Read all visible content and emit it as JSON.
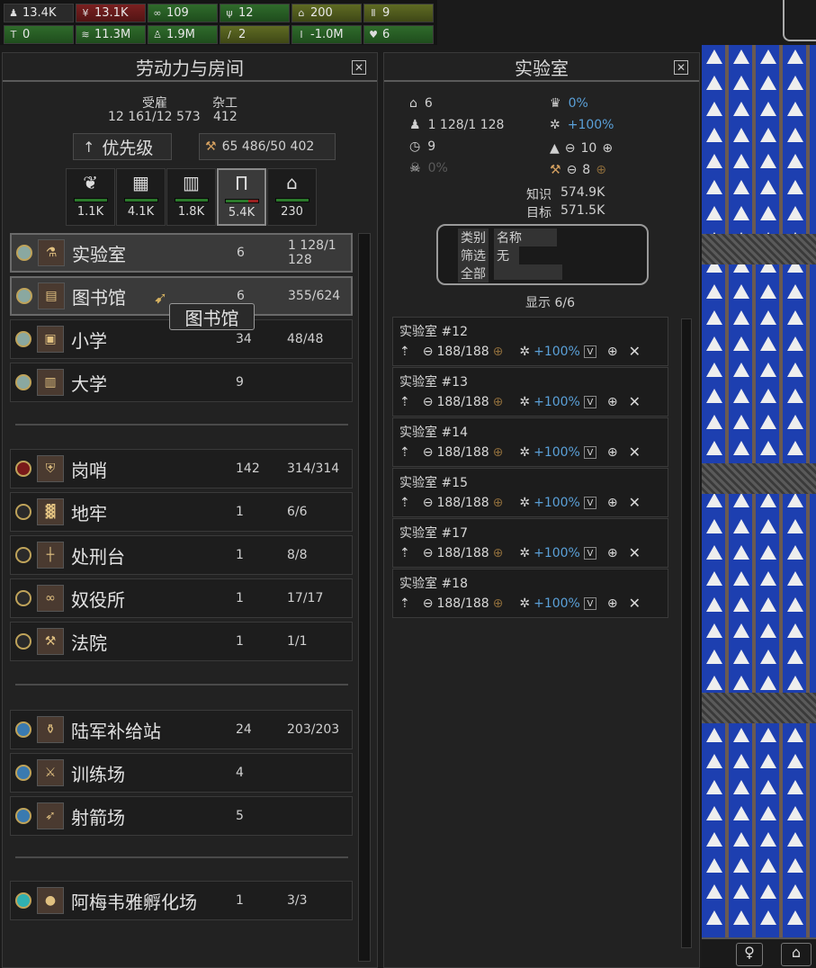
{
  "top": {
    "row1": [
      {
        "icon": "worker-icon",
        "glyph": "♟",
        "value": "13.4K",
        "color": "dark"
      },
      {
        "icon": "crop-icon",
        "glyph": "¥",
        "value": "13.1K",
        "color": "red"
      },
      {
        "icon": "chain-icon",
        "glyph": "∞",
        "value": "109",
        "color": "green"
      },
      {
        "icon": "wheat-icon",
        "glyph": "ψ",
        "value": "12",
        "color": "green"
      },
      {
        "icon": "house-icon",
        "glyph": "⌂",
        "value": "200",
        "color": "olive"
      },
      {
        "icon": "pillar-icon",
        "glyph": "Ⅱ",
        "value": "9",
        "color": "olive"
      }
    ],
    "row2": [
      {
        "icon": "hammer-icon",
        "glyph": "T",
        "value": "0",
        "color": "green"
      },
      {
        "icon": "coins-icon",
        "glyph": "≋",
        "value": "11.3M",
        "color": "green"
      },
      {
        "icon": "flask-icon",
        "glyph": "♙",
        "value": "1.9M",
        "color": "green"
      },
      {
        "icon": "sword-icon",
        "glyph": "/",
        "value": "2",
        "color": "olive"
      },
      {
        "icon": "person-icon",
        "glyph": "I",
        "value": "-1.0M",
        "color": "green"
      },
      {
        "icon": "heart-icon",
        "glyph": "♥",
        "value": "6",
        "color": "green"
      }
    ]
  },
  "left": {
    "title": "劳动力与房间",
    "employed_label": "受雇",
    "employed_value": "12 161/12 573",
    "odd_label": "杂工",
    "odd_value": "412",
    "priority_label": "优先级",
    "work_value": "65 486/50 402",
    "tabs": [
      {
        "icon": "nature-icon",
        "glyph": "❦",
        "value": "1.1K"
      },
      {
        "icon": "factory-icon",
        "glyph": "▦",
        "value": "4.1K"
      },
      {
        "icon": "temple-icon",
        "glyph": "▥",
        "value": "1.8K"
      },
      {
        "icon": "column-icon",
        "glyph": "Π",
        "value": "5.4K"
      },
      {
        "icon": "home-icon",
        "glyph": "⌂",
        "value": "230"
      }
    ],
    "group1": [
      {
        "name": "实验室",
        "count": "6",
        "cap": "1 128/1 128",
        "icon": "flask-room-icon",
        "glyph": "⚗"
      },
      {
        "name": "图书馆",
        "count": "6",
        "cap": "355/624",
        "icon": "book-room-icon",
        "glyph": "▤"
      },
      {
        "name": "小学",
        "count": "34",
        "cap": "48/48",
        "icon": "school-room-icon",
        "glyph": "▣"
      },
      {
        "name": "大学",
        "count": "9",
        "cap": "",
        "icon": "university-room-icon",
        "glyph": "▥"
      }
    ],
    "tooltip": "图书馆",
    "group2": [
      {
        "name": "岗哨",
        "count": "142",
        "cap": "314/314",
        "icon": "shield-room-icon",
        "glyph": "⛨"
      },
      {
        "name": "地牢",
        "count": "1",
        "cap": "6/6",
        "icon": "dungeon-room-icon",
        "glyph": "▓"
      },
      {
        "name": "处刑台",
        "count": "1",
        "cap": "8/8",
        "icon": "execution-room-icon",
        "glyph": "┼"
      },
      {
        "name": "奴役所",
        "count": "1",
        "cap": "17/17",
        "icon": "slave-room-icon",
        "glyph": "∞"
      },
      {
        "name": "法院",
        "count": "1",
        "cap": "1/1",
        "icon": "gavel-room-icon",
        "glyph": "⚒"
      }
    ],
    "group3": [
      {
        "name": "陆军补给站",
        "count": "24",
        "cap": "203/203",
        "icon": "supply-room-icon",
        "glyph": "⚱"
      },
      {
        "name": "训练场",
        "count": "4",
        "cap": "",
        "icon": "training-room-icon",
        "glyph": "⚔"
      },
      {
        "name": "射箭场",
        "count": "5",
        "cap": "",
        "icon": "archery-room-icon",
        "glyph": "➶"
      }
    ],
    "group4": [
      {
        "name": "阿梅韦雅孵化场",
        "count": "1",
        "cap": "3/3",
        "icon": "hatchery-room-icon",
        "glyph": "●"
      }
    ]
  },
  "middle": {
    "title": "实验室",
    "rooms": "6",
    "workers": "1 128/1 128",
    "time": "9",
    "death": "0%",
    "crown": "0%",
    "gear": "+100%",
    "minus1": "10",
    "minus2": "8",
    "knowledge_label": "知识",
    "knowledge_value": "574.9K",
    "target_label": "目标",
    "target_value": "571.5K",
    "sort_label": "类别",
    "sort_value": "名称",
    "filter_label": "筛选",
    "filter_value": "无",
    "all_label": "全部",
    "show_label": "显示 6/6",
    "cards": [
      {
        "title": "实验室 #12",
        "workers": "188/188",
        "bonus": "+100%"
      },
      {
        "title": "实验室 #13",
        "workers": "188/188",
        "bonus": "+100%"
      },
      {
        "title": "实验室 #14",
        "workers": "188/188",
        "bonus": "+100%"
      },
      {
        "title": "实验室 #15",
        "workers": "188/188",
        "bonus": "+100%"
      },
      {
        "title": "实验室 #17",
        "workers": "188/188",
        "bonus": "+100%"
      },
      {
        "title": "实验室 #18",
        "workers": "188/188",
        "bonus": "+100%"
      }
    ]
  }
}
